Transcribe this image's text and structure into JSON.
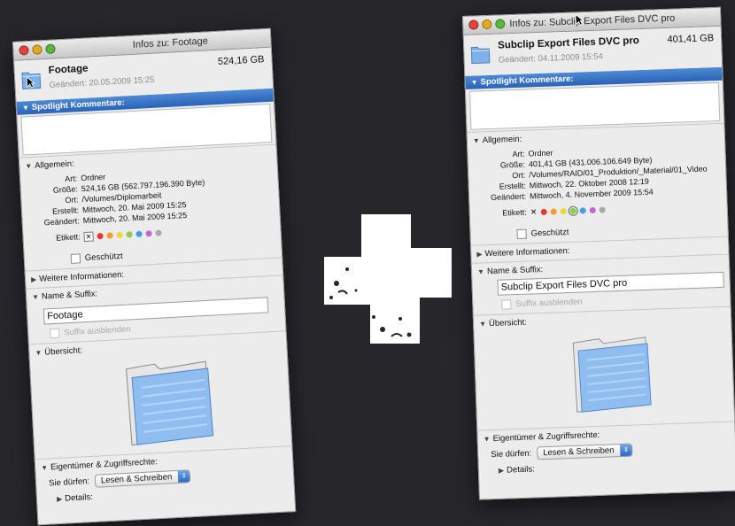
{
  "left": {
    "window_title": "Infos zu: Footage",
    "name": "Footage",
    "size": "524,16 GB",
    "modified_header": "Geändert: 20.05.2009 15:25",
    "spotlight_header": "Spotlight Kommentare:",
    "general_header": "Allgemein:",
    "rows": [
      {
        "k": "Art:",
        "v": "Ordner"
      },
      {
        "k": "Größe:",
        "v": "524,16 GB (562.797.196.390 Byte)"
      },
      {
        "k": "Ort:",
        "v": "/Volumes/Diplomarbeit"
      },
      {
        "k": "Erstellt:",
        "v": "Mittwoch, 20. Mai 2009 15:25"
      },
      {
        "k": "Geändert:",
        "v": "Mittwoch, 20. Mai 2009 15:25"
      }
    ],
    "label_key": "Etikett:",
    "label_x": "✕",
    "locked": "Geschützt",
    "more_info": "Weitere Informationen:",
    "name_header": "Name & Suffix:",
    "name_value": "Footage",
    "hide_ext": "Suffix ausblenden",
    "preview_header": "Übersicht:",
    "perm_header": "Eigentümer & Zugriffsrechte:",
    "perm_label": "Sie dürfen:",
    "perm_value": "Lesen & Schreiben",
    "details": "Details:"
  },
  "right": {
    "window_title": "Infos zu: Subclip Export Files DVC pro",
    "name": "Subclip Export Files DVC pro",
    "size": "401,41 GB",
    "modified_header": "Geändert: 04.11.2009 15:54",
    "spotlight_header": "Spotlight Kommentare:",
    "general_header": "Allgemein:",
    "rows": [
      {
        "k": "Art:",
        "v": "Ordner"
      },
      {
        "k": "Größe:",
        "v": "401,41 GB (431.006.106.649 Byte)"
      },
      {
        "k": "Ort:",
        "v": "/Volumes/RAID/01_Produktion/_Material/01_Video"
      },
      {
        "k": "Erstellt:",
        "v": "Mittwoch, 22. Oktober 2008 12:19"
      },
      {
        "k": "Geändert:",
        "v": "Mittwoch, 4. November 2009 15:54"
      }
    ],
    "label_key": "Etikett:",
    "label_x": "✕",
    "locked": "Geschützt",
    "more_info": "Weitere Informationen:",
    "name_header": "Name & Suffix:",
    "name_value": "Subclip Export Files DVC pro",
    "hide_ext": "Suffix ausblenden",
    "preview_header": "Übersicht:",
    "perm_header": "Eigentümer & Zugriffsrechte:",
    "perm_label": "Sie dürfen:",
    "perm_value": "Lesen & Schreiben",
    "details": "Details:"
  },
  "label_colors": [
    "#e8392f",
    "#f39a2b",
    "#f1d63a",
    "#8ccf45",
    "#3f9de9",
    "#c465d6",
    "#a8a8a8"
  ],
  "traffic_lights": [
    "#e2433a",
    "#e9a91f",
    "#5ab93c"
  ]
}
